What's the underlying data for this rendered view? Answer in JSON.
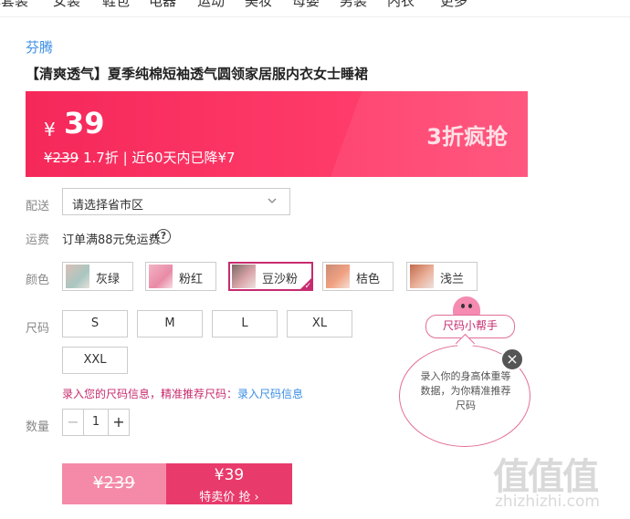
{
  "top_nav": [
    "裤套装",
    "女装",
    "鞋包",
    "电器",
    "运动",
    "美妆",
    "母婴",
    "男装",
    "内衣",
    "更多"
  ],
  "brand": "芬腾",
  "product_title": "【清爽透气】夏季纯棉短袖透气圆领家居服内衣女士睡裙",
  "price": {
    "currency": "¥",
    "value": "39",
    "original": "¥239",
    "discount": "1.7折",
    "history": "| 近60天内已降¥7",
    "promo": "3折疯抢"
  },
  "delivery": {
    "label": "配送",
    "placeholder": "请选择省市区",
    "chevron_icon": "chevron-down-icon"
  },
  "shipping": {
    "label": "运费",
    "text": "订单满88元免运费",
    "help_icon": "question-circle-icon",
    "help_glyph": "?"
  },
  "colors": {
    "label": "颜色",
    "options": [
      {
        "name": "灰绿",
        "selected": false
      },
      {
        "name": "粉红",
        "selected": false
      },
      {
        "name": "豆沙粉",
        "selected": true
      },
      {
        "name": "桔色",
        "selected": false
      },
      {
        "name": "浅兰",
        "selected": false
      }
    ]
  },
  "sizes": {
    "label": "尺码",
    "options": [
      "S",
      "M",
      "L",
      "XL",
      "XXL"
    ]
  },
  "size_tip": {
    "text": "录入您的尺码信息，精准推荐尺码：",
    "link": "录入尺码信息"
  },
  "quantity": {
    "label": "数量",
    "value": "1",
    "minus": "−",
    "plus": "+"
  },
  "buy": {
    "original": "¥239",
    "price": "¥39",
    "action": "特卖价 抢 ›"
  },
  "size_helper": {
    "tag": "尺码小帮手",
    "bubble_text": "录入你的身高体重等数据，为你精准推荐尺码",
    "close_glyph": "×"
  },
  "watermark": {
    "logo": "值值值",
    "url": "zhizhizhi.com"
  },
  "colors_palette": {
    "accent": "#f5285a",
    "selected_border": "#c72b6f",
    "link": "#3a8ee6",
    "buy_dark": "#e83a6b",
    "buy_light": "#f48aa8"
  }
}
